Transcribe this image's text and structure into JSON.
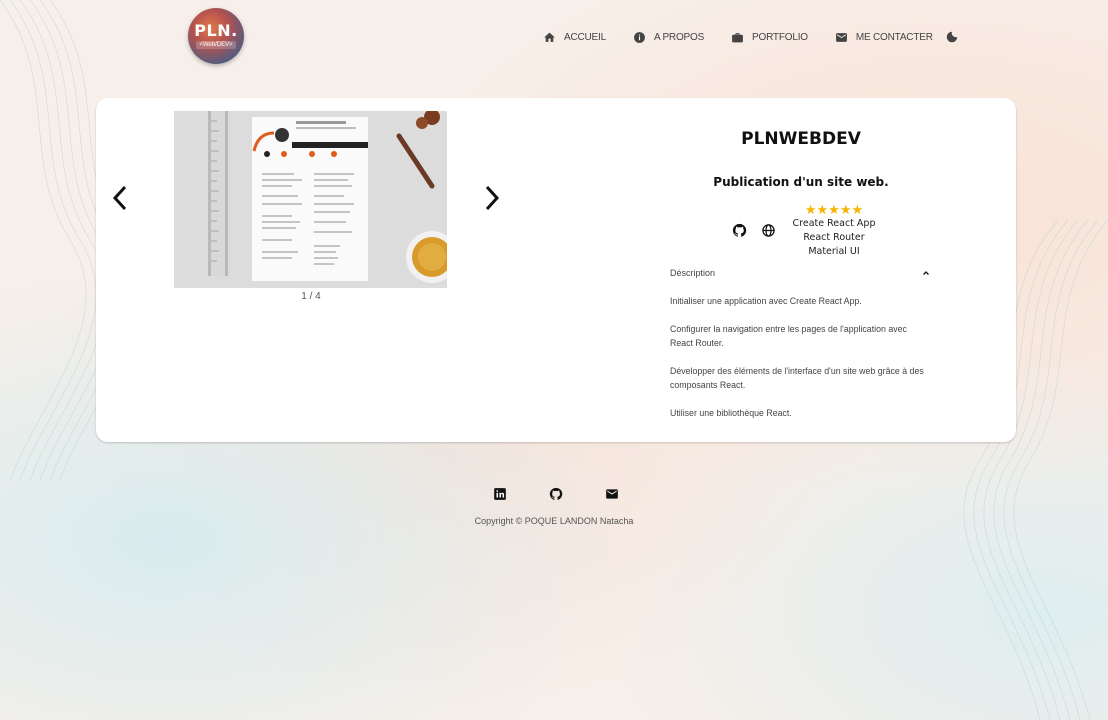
{
  "header": {
    "logo": {
      "main": "PLN.",
      "sub": "<Web/DEV>"
    },
    "nav": [
      {
        "label": "ACCUEIL",
        "icon": "home-icon"
      },
      {
        "label": "A PROPOS",
        "icon": "info-icon"
      },
      {
        "label": "PORTFOLIO",
        "icon": "briefcase-icon"
      },
      {
        "label": "ME CONTACTER",
        "icon": "mail-icon"
      }
    ],
    "theme_toggle_icon": "moon-icon"
  },
  "project": {
    "carousel": {
      "current": 1,
      "total": 4,
      "counter": "1 / 4"
    },
    "title": "PLNWEBDEV",
    "subtitle": "Publication d'un site web.",
    "links": [
      "github-icon",
      "globe-icon"
    ],
    "rating": "★★★★★",
    "technologies": [
      "Create React App",
      "React Router",
      "Material UI"
    ],
    "description_label": "Déscription",
    "description": [
      "Initialiser une application avec Create React App.",
      "Configurer la navigation entre les pages de l'application avec React Router.",
      "Développer des éléments de l'interface d'un site web grâce à des composants React.",
      "Utiliser une bibliothèque React."
    ]
  },
  "footer": {
    "icons": [
      "linkedin-icon",
      "github-icon",
      "mail-icon"
    ],
    "copyright": "Copyright © POQUE LANDON Natacha"
  },
  "colors": {
    "star": "#f5b400",
    "logo_orange": "#e07a4a",
    "logo_blue": "#4a5d87",
    "text_dark": "#111111"
  }
}
